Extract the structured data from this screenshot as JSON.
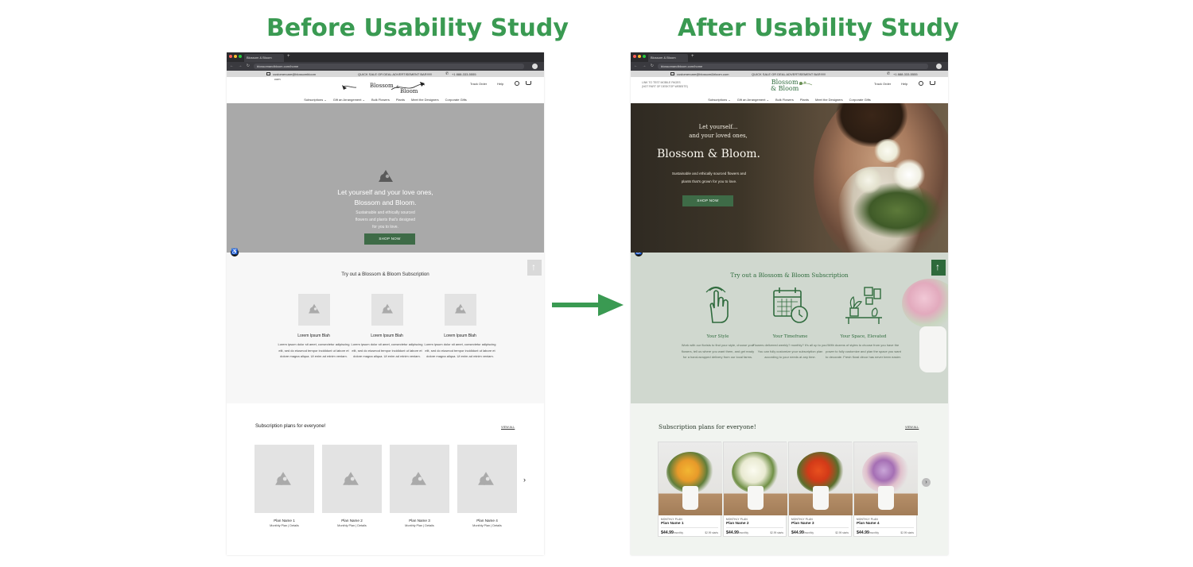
{
  "headings": {
    "before": "Before Usability Study",
    "after": "After Usability Study"
  },
  "browser": {
    "tab_title": "Blossom & Bloom",
    "tab_plus": "+",
    "url": "blossomandbloom.com/home",
    "nav_glyphs": "← → ↻ ⌂"
  },
  "promo": {
    "email_left": "customercare@blossombloom",
    "email_left_cont": "com",
    "email_right": "customercare@blossom&bloom.com",
    "deal": "QUICK SALE OR DEAL ADVERTISEMENT BAR!!!!!!",
    "phone": "+1 888-333-5555"
  },
  "header": {
    "logo_line1": "Blossom",
    "logo_amp": "&",
    "logo_line2": "Bloom",
    "track_order": "Track Order",
    "help": "Help",
    "note": "LINK TO TEST MOBILE PAGES\n(NOT PART OF DESKTOP WEBSITE)"
  },
  "nav": {
    "items": [
      "Subscriptions ⌄",
      "Gift an Arrangement ⌄",
      "Bulk Flowers",
      "Plants",
      "Meet the Designers",
      "Corporate Gifts"
    ]
  },
  "hero_before": {
    "title_line1": "Let yourself and your love ones,",
    "title_line2": "Blossom and Bloom.",
    "sub_line1": "Sustainable and ethically sourced",
    "sub_line2": "flowers and plants that's designed",
    "sub_line3": "for you to love.",
    "button": "SHOP NOW"
  },
  "hero_after": {
    "tag_line1": "Let yourself...",
    "tag_line2": "and your loved ones,",
    "title": "Blossom & Bloom.",
    "sub_line1": "Sustainable and ethically sourced flowers and",
    "sub_line2": "plants that's grown for you to love.",
    "button": "SHOP NOW"
  },
  "trial_before": {
    "title": "Try out a Blossom & Bloom Subscription",
    "items": [
      {
        "title": "Lorem Ipsum Blah",
        "body": "Lorem ipsum dolor sit amet, consectetur adipiscing elit, sed do eiusmod tempor incididunt ut labore et dolore magna aliqua. Ut enim ad minim veniam."
      },
      {
        "title": "Lorem Ipsum Blah",
        "body": "Lorem ipsum dolor sit amet, consectetur adipiscing elit, sed do eiusmod tempor incididunt ut labore et dolore magna aliqua. Ut enim ad minim veniam."
      },
      {
        "title": "Lorem Ipsum Blah",
        "body": "Lorem ipsum dolor sit amet, consectetur adipiscing elit, sed do eiusmod tempor incididunt ut labore et dolore magna aliqua. Ut enim ad minim veniam."
      }
    ]
  },
  "trial_after": {
    "title": "Try out a Blossom & Bloom Subscription",
    "items": [
      {
        "title": "Your Style",
        "body": "Work with our florists to find your style, choose your flowers, tell us where you want them, and get ready for a hand-wrapped delivery from our local farms."
      },
      {
        "title": "Your Timeframe",
        "body": "Flowers delivered weekly? monthly? It's all up to you! You can fully customize your subscription plan according to your needs at any time."
      },
      {
        "title": "Your Space, Elevated",
        "body": "With dozens of styles to choose from you have the power to fully customize and plan the space you want to decorate. Fresh floral décor has never been easier."
      }
    ]
  },
  "plans_before": {
    "title": "Subscription plans for everyone!",
    "view_all": "VIEW ALL",
    "cards": [
      {
        "name": "Plan Name 1",
        "sub": "Monthly Plan | Details"
      },
      {
        "name": "Plan Name 2",
        "sub": "Monthly Plan | Details"
      },
      {
        "name": "Plan Name 3",
        "sub": "Monthly Plan | Details"
      },
      {
        "name": "Plan Name 4",
        "sub": "Monthly Plan | Details"
      }
    ]
  },
  "plans_after": {
    "title": "Subscription plans for everyone!",
    "view_all": "VIEW ALL",
    "cards": [
      {
        "tag": "MONTHLY PLAN",
        "name": "Plan Name 1",
        "price": "$44.99",
        "unit": "/monthly",
        "extra": "$2.99 starts"
      },
      {
        "tag": "MONTHLY PLAN",
        "name": "Plan Name 2",
        "price": "$44.99",
        "unit": "/monthly",
        "extra": "$2.99 starts"
      },
      {
        "tag": "MONTHLY PLAN",
        "name": "Plan Name 3",
        "price": "$44.99",
        "unit": "/monthly",
        "extra": "$2.99 starts"
      },
      {
        "tag": "MONTHLY PLAN",
        "name": "Plan Name 4",
        "price": "$44.99",
        "unit": "/monthly",
        "extra": "$2.99 starts"
      }
    ]
  },
  "colors": {
    "heading_green": "#3a9a52",
    "brand_green": "#2f6b3d",
    "button_green": "#3e6b47",
    "placeholder_gray": "#a9a9a9",
    "sage": "#d0d8cf"
  },
  "icons": {
    "accessibility": "accessibility-icon",
    "up": "arrow-up-icon",
    "next": "chevron-right-icon",
    "transition": "arrow-right-icon"
  },
  "glyphs": {
    "accessibility": "♿",
    "up": "↑",
    "chevron": "›"
  }
}
